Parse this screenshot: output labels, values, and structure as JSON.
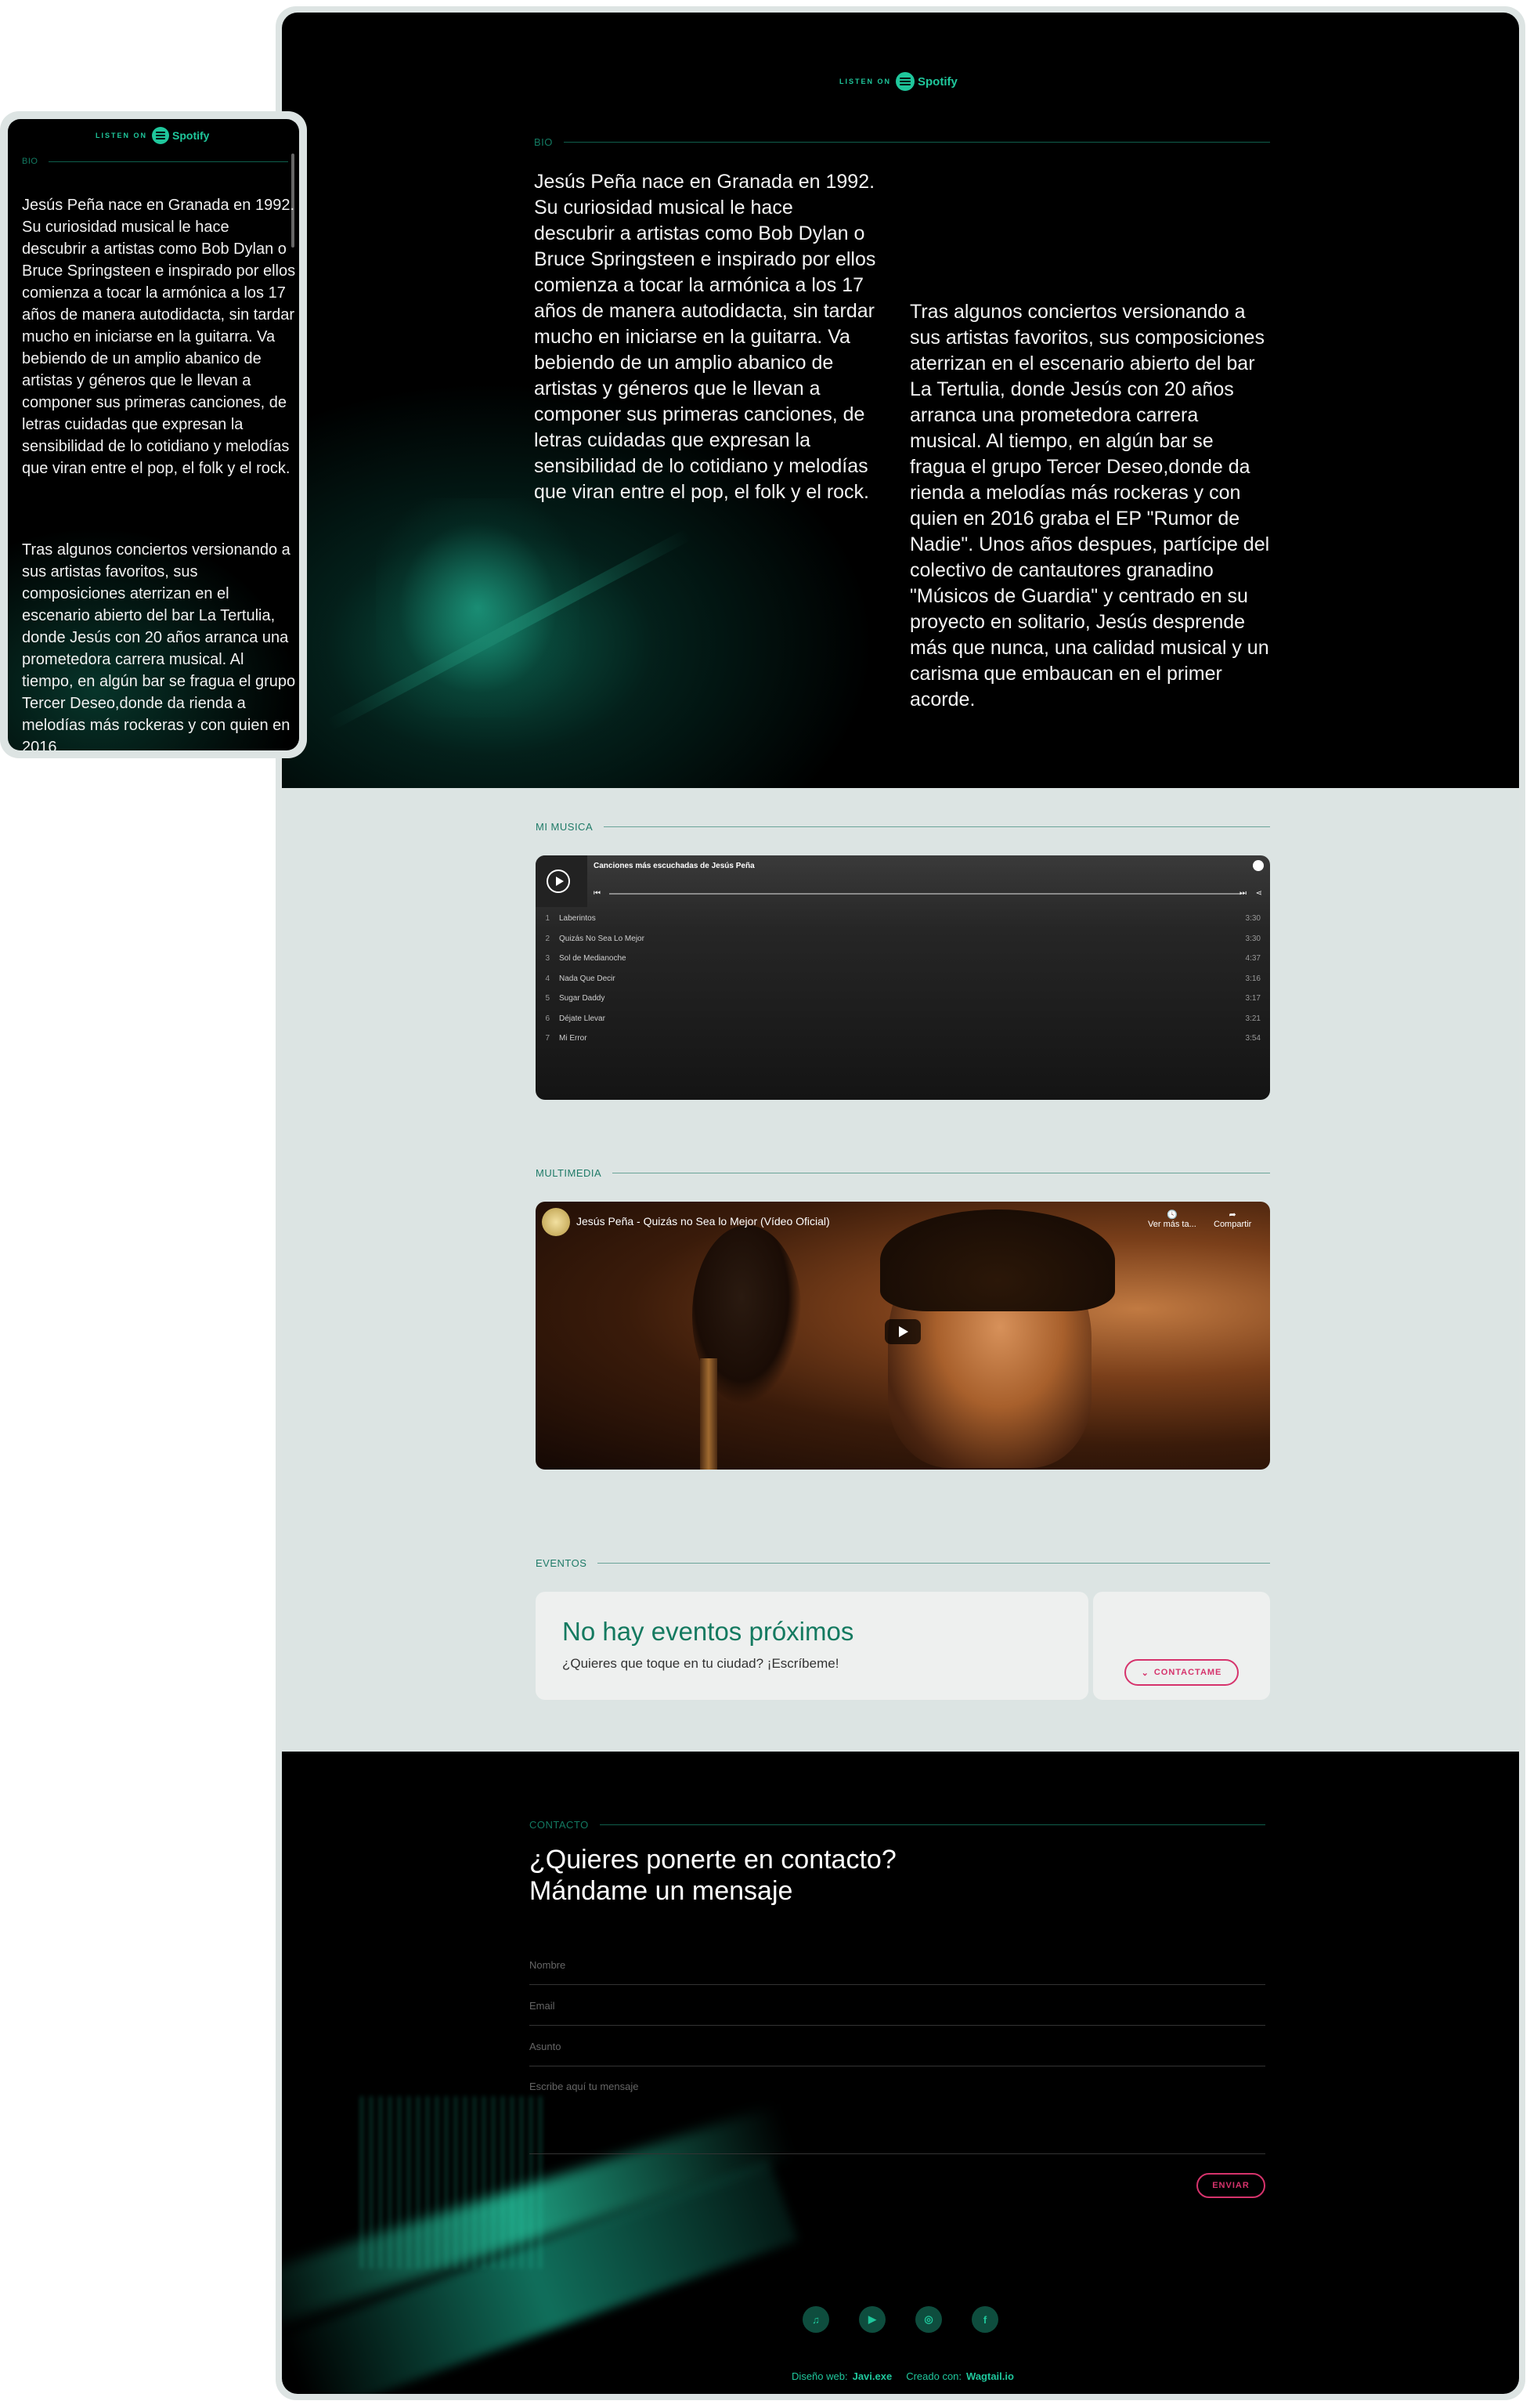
{
  "brand": {
    "listen_on": "LISTEN ON",
    "spotify": "Spotify",
    "accent": "#1fc79c",
    "pink": "#d6336c"
  },
  "bio": {
    "label": "BIO",
    "p1": "Jesús Peña nace en Granada en 1992. Su curiosidad musical le hace descubrir a artistas como Bob Dylan o Bruce Springsteen e inspirado por ellos comienza a tocar la armónica a los 17 años de manera autodidacta, sin tardar mucho en iniciarse en la guitarra. Va bebiendo de un amplio abanico de artistas y géneros que le llevan a componer sus primeras canciones, de letras cuidadas que expresan la sensibilidad de lo cotidiano y melodías que viran entre el pop, el folk y el rock.",
    "p2": "Tras algunos conciertos versionando a sus artistas favoritos, sus composiciones aterrizan en el escenario abierto del bar La Tertulia, donde Jesús con 20 años arranca una prometedora carrera musical. Al tiempo, en algún bar se fragua el grupo Tercer Deseo,donde da rienda a melodías más rockeras y con quien en 2016 graba el EP \"Rumor de Nadie\". Unos años despues, partícipe del colectivo de cantautores granadino \"Músicos de Guardia\" y centrado en su proyecto en solitario, Jesús desprende más que nunca, una calidad musical y un carisma que embaucan en el primer acorde.",
    "p2_mobile": "Tras algunos conciertos versionando a sus artistas favoritos, sus composiciones aterrizan en el escenario abierto del bar La Tertulia, donde Jesús con 20 años arranca una prometedora carrera musical. Al tiempo, en algún bar se fragua el grupo Tercer Deseo,donde da rienda a melodías más rockeras y con quien en 2016"
  },
  "music": {
    "label": "MI MUSICA",
    "playlist_title": "Canciones más escuchadas de Jesús Peña",
    "tracks": [
      {
        "n": "1",
        "title": "Laberintos",
        "dur": "3:30"
      },
      {
        "n": "2",
        "title": "Quizás No Sea Lo Mejor",
        "dur": "3:30"
      },
      {
        "n": "3",
        "title": "Sol de Medianoche",
        "dur": "4:37"
      },
      {
        "n": "4",
        "title": "Nada Que Decir",
        "dur": "3:16"
      },
      {
        "n": "5",
        "title": "Sugar Daddy",
        "dur": "3:17"
      },
      {
        "n": "6",
        "title": "Déjate Llevar",
        "dur": "3:21"
      },
      {
        "n": "7",
        "title": "Mi Error",
        "dur": "3:54"
      }
    ]
  },
  "multimedia": {
    "label": "MULTIMEDIA",
    "video_title": "Jesús Peña - Quizás no Sea lo Mejor (Vídeo Oficial)",
    "watch_later": "Ver más ta...",
    "share": "Compartir"
  },
  "events": {
    "label": "EVENTOS",
    "title": "No hay eventos próximos",
    "subtitle": "¿Quieres que toque en tu ciudad? ¡Escríbeme!",
    "button": "CONTACTAME"
  },
  "contact": {
    "label": "CONTACTO",
    "heading_line1": "¿Quieres ponerte en contacto?",
    "heading_line2": "Mándame un mensaje",
    "name_placeholder": "Nombre",
    "email_placeholder": "Email",
    "subject_placeholder": "Asunto",
    "message_placeholder": "Escribe aquí tu mensaje",
    "submit": "ENVIAR"
  },
  "footer": {
    "socials": [
      "spotify-icon",
      "youtube-icon",
      "instagram-icon",
      "facebook-icon"
    ],
    "design_label": "Diseño web:",
    "design_by": "Javi.exe",
    "made_label": "Creado con:",
    "made_with": "Wagtail.io"
  }
}
